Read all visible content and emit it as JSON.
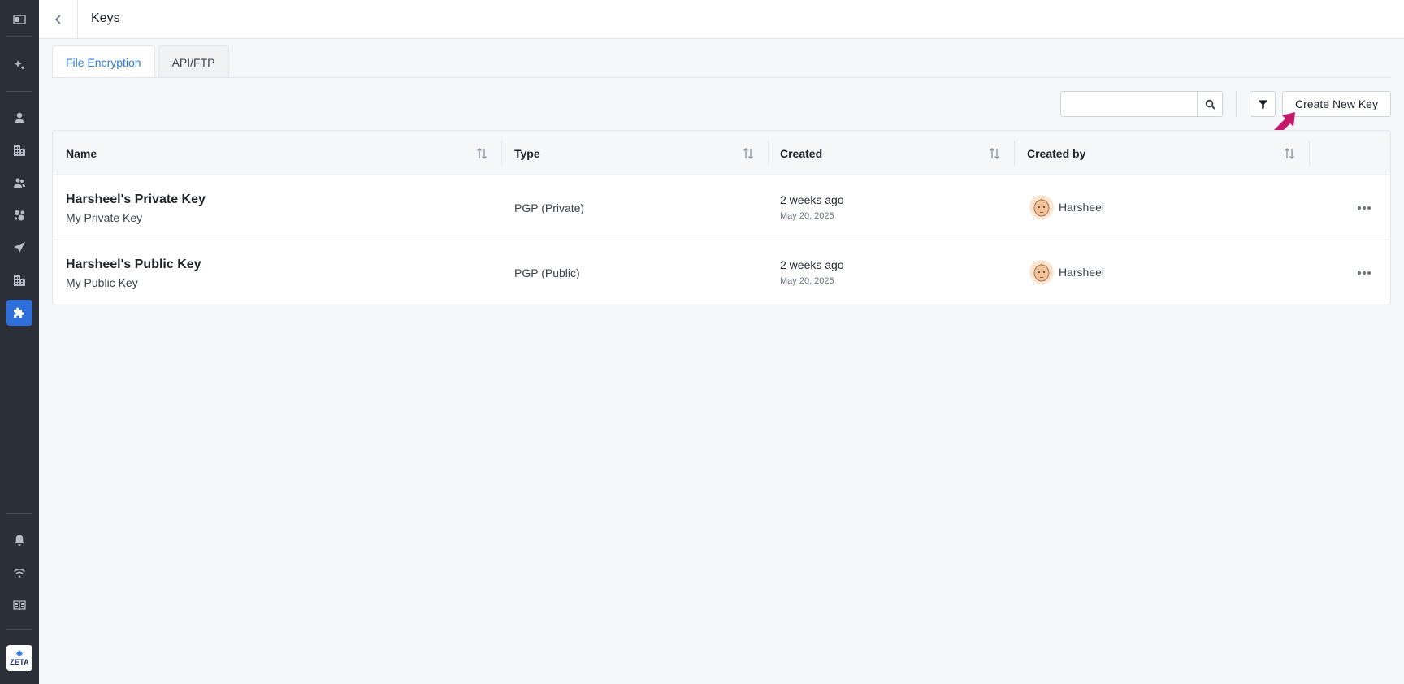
{
  "sidebar": {
    "icons": [
      "panel-toggle-icon",
      "sparkle-icon",
      "user-icon",
      "building-icon",
      "users-icon",
      "segments-icon",
      "send-icon",
      "organization-icon",
      "puzzle-icon",
      "bell-icon",
      "signal-icon",
      "book-icon"
    ],
    "active_item": "puzzle-icon",
    "logo_text": "ZETA"
  },
  "header": {
    "title": "Keys"
  },
  "tabs": [
    {
      "label": "File Encryption",
      "active": true
    },
    {
      "label": "API/FTP",
      "active": false
    }
  ],
  "toolbar": {
    "search_placeholder": "",
    "create_label": "Create New Key"
  },
  "table": {
    "columns": [
      "Name",
      "Type",
      "Created",
      "Created by"
    ],
    "rows": [
      {
        "name": "Harsheel's Private Key",
        "description": "My Private Key",
        "type": "PGP (Private)",
        "created_relative": "2 weeks ago",
        "created_date": "May 20, 2025",
        "created_by": "Harsheel"
      },
      {
        "name": "Harsheel's Public Key",
        "description": "My Public Key",
        "type": "PGP (Public)",
        "created_relative": "2 weeks ago",
        "created_date": "May 20, 2025",
        "created_by": "Harsheel"
      }
    ]
  },
  "colors": {
    "sidebar_bg": "#2b2f38",
    "accent": "#2f6fdb",
    "active_tab_text": "#2f7ed8",
    "pointer_arrow": "#c2186b"
  }
}
